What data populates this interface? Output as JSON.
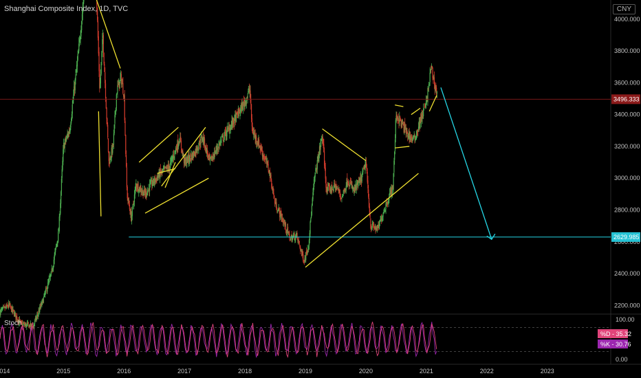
{
  "header": {
    "title": "Shanghai Composite Index, 1D, TVC",
    "currency": "CNY"
  },
  "colors": {
    "background": "#000000",
    "up_candle": "#4caf50",
    "down_candle": "#d33b2c",
    "resistance_line": "#7a1a1a",
    "support_line": "#25d7e6",
    "pattern_lines": "#f0e130",
    "stoch_k": "#e0447a",
    "stoch_d": "#9c27b0"
  },
  "chart_data": [
    {
      "type": "candlestick",
      "title": "Shanghai Composite Index, 1D, TVC",
      "x_ticks": [
        "2014",
        "2015",
        "2016",
        "2017",
        "2018",
        "2019",
        "2020",
        "2021",
        "2022",
        "2023"
      ],
      "y_ticks": [
        "4000.000",
        "3800.000",
        "3600.000",
        "3400.000",
        "3200.000",
        "3000.000",
        "2800.000",
        "2600.000",
        "2400.000",
        "2200.000"
      ],
      "ylim": [
        2150,
        4120
      ],
      "xlim": [
        2013.95,
        2024.55
      ],
      "price_path": [
        [
          2013.95,
          2160
        ],
        [
          2014.1,
          2200
        ],
        [
          2014.3,
          2080
        ],
        [
          2014.5,
          2070
        ],
        [
          2014.65,
          2220
        ],
        [
          2014.8,
          2400
        ],
        [
          2014.92,
          2660
        ],
        [
          2015.0,
          3200
        ],
        [
          2015.1,
          3300
        ],
        [
          2015.25,
          3800
        ],
        [
          2015.4,
          4400
        ],
        [
          2015.5,
          5100
        ],
        [
          2015.55,
          4100
        ],
        [
          2015.6,
          3550
        ],
        [
          2015.65,
          3900
        ],
        [
          2015.75,
          3100
        ],
        [
          2015.82,
          3200
        ],
        [
          2015.88,
          3550
        ],
        [
          2015.95,
          3630
        ],
        [
          2016.0,
          3530
        ],
        [
          2016.05,
          2900
        ],
        [
          2016.12,
          2750
        ],
        [
          2016.2,
          2960
        ],
        [
          2016.35,
          2900
        ],
        [
          2016.45,
          2960
        ],
        [
          2016.6,
          3030
        ],
        [
          2016.75,
          3070
        ],
        [
          2016.92,
          3250
        ],
        [
          2017.0,
          3100
        ],
        [
          2017.15,
          3150
        ],
        [
          2017.3,
          3260
        ],
        [
          2017.42,
          3100
        ],
        [
          2017.6,
          3230
        ],
        [
          2017.85,
          3380
        ],
        [
          2018.0,
          3480
        ],
        [
          2018.08,
          3560
        ],
        [
          2018.12,
          3300
        ],
        [
          2018.25,
          3200
        ],
        [
          2018.4,
          3050
        ],
        [
          2018.5,
          2840
        ],
        [
          2018.6,
          2760
        ],
        [
          2018.75,
          2620
        ],
        [
          2018.85,
          2640
        ],
        [
          2018.98,
          2480
        ],
        [
          2019.05,
          2580
        ],
        [
          2019.15,
          3000
        ],
        [
          2019.28,
          3270
        ],
        [
          2019.35,
          2920
        ],
        [
          2019.5,
          2950
        ],
        [
          2019.6,
          2880
        ],
        [
          2019.7,
          2990
        ],
        [
          2019.8,
          2920
        ],
        [
          2019.92,
          2990
        ],
        [
          2020.0,
          3100
        ],
        [
          2020.08,
          2700
        ],
        [
          2020.2,
          2680
        ],
        [
          2020.3,
          2800
        ],
        [
          2020.45,
          2950
        ],
        [
          2020.5,
          3400
        ],
        [
          2020.58,
          3350
        ],
        [
          2020.7,
          3270
        ],
        [
          2020.8,
          3240
        ],
        [
          2020.9,
          3360
        ],
        [
          2021.0,
          3470
        ],
        [
          2021.08,
          3700
        ],
        [
          2021.12,
          3620
        ],
        [
          2021.18,
          3520
        ]
      ],
      "horizontal_levels": [
        {
          "label": "3496.333",
          "value": 3496.333
        },
        {
          "label": "2629.985",
          "value": 2629.985
        }
      ]
    },
    {
      "type": "line",
      "title": "Stoch",
      "y_ticks": [
        "100.00",
        "0.00"
      ],
      "ylim": [
        0,
        100
      ],
      "series": [
        {
          "name": "%D",
          "last_value": 35.32
        },
        {
          "name": "%K",
          "last_value": 30.76
        }
      ],
      "legend_badges": [
        "%D - 35.32",
        "%K - 30.76"
      ]
    }
  ]
}
